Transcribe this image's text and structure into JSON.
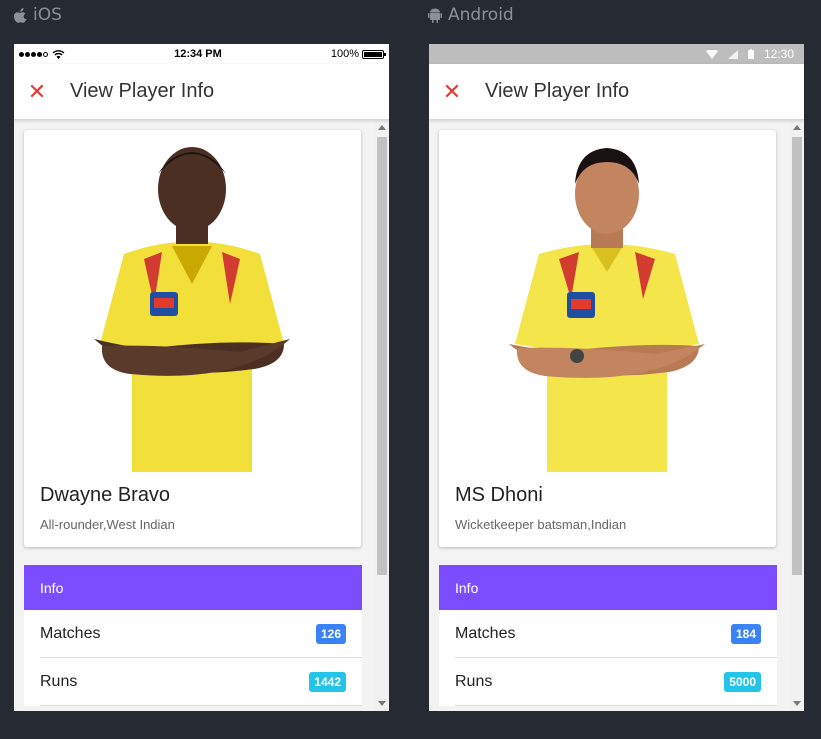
{
  "platforms": {
    "ios_label": "iOS",
    "android_label": "Android"
  },
  "ios": {
    "status": {
      "time": "12:34 PM",
      "battery": "100%"
    },
    "title": "View Player Info",
    "player": {
      "name": "Dwayne Bravo",
      "role": "All-rounder,West Indian"
    },
    "info_header": "Info",
    "stats": [
      {
        "label": "Matches",
        "value": "126",
        "color": "#3b82f6"
      },
      {
        "label": "Runs",
        "value": "1442",
        "color": "#22c5e8"
      }
    ]
  },
  "android": {
    "status": {
      "time": "12:30"
    },
    "title": "View Player Info",
    "player": {
      "name": "MS Dhoni",
      "role": "Wicketkeeper batsman,Indian"
    },
    "info_header": "Info",
    "stats": [
      {
        "label": "Matches",
        "value": "184",
        "color": "#3b82f6"
      },
      {
        "label": "Runs",
        "value": "5000",
        "color": "#22c5e8"
      }
    ]
  },
  "colors": {
    "accent": "#7c4dff",
    "close": "#e53935",
    "jersey": "#f4e64a"
  },
  "icons": {
    "ios": "apple-icon",
    "android": "android-icon",
    "close": "close-icon"
  }
}
